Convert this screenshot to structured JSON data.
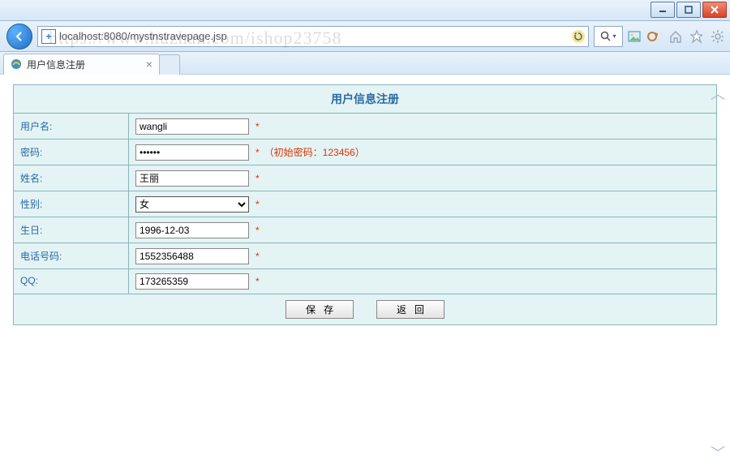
{
  "window": {
    "minimize": "–",
    "maximize": "□",
    "close": "×"
  },
  "toolbar": {
    "back_icon": "←",
    "url": "localhost:8080/mystnstravepage.jsp"
  },
  "tab": {
    "title": "用户信息注册"
  },
  "ghost_text": "https://www.huzhan.com/ishop23758",
  "form": {
    "title": "用户信息注册",
    "required_mark": "*",
    "labels": {
      "username": "用户名:",
      "password": "密码:",
      "realname": "姓名:",
      "gender": "性别:",
      "birthday": "生日:",
      "phone": "电话号码:",
      "qq": "QQ:"
    },
    "values": {
      "username": "wangli",
      "password": "••••••",
      "realname": "王丽",
      "gender": "女",
      "birthday": "1996-12-03",
      "phone": "1552356488",
      "qq": "173265359"
    },
    "password_hint": "（初始密码：123456）",
    "buttons": {
      "save": "保存",
      "back": "返回"
    }
  }
}
